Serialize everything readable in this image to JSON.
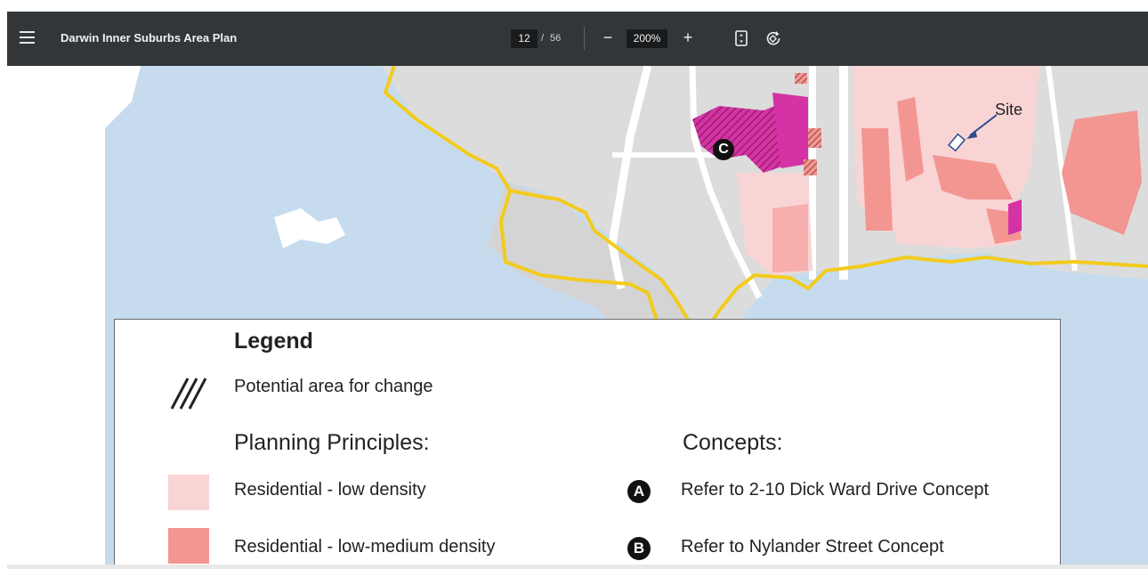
{
  "toolbar": {
    "title": "Darwin Inner Suburbs Area Plan",
    "page_current": "12",
    "page_separator": "/",
    "page_total": "56",
    "zoom_out": "−",
    "zoom_level": "200%",
    "zoom_in": "+",
    "icons": [
      "menu-icon",
      "fit-to-page-icon",
      "rotate-icon"
    ]
  },
  "map": {
    "site_label": "Site",
    "marker_c": "C",
    "colors": {
      "water": "#c6dcee",
      "land_grey": "#dcdcdc",
      "boundary": "#f2cb1d",
      "low_density": "#f9d4d4",
      "low_medium_density": "#f39692",
      "magenta": "#d533a5"
    }
  },
  "legend": {
    "title": "Legend",
    "hatch_label": "Potential area for change",
    "planning_title": "Planning Principles:",
    "concepts_title": "Concepts:",
    "items": [
      {
        "label": "Residential - low density",
        "color": "#f9d4d4"
      },
      {
        "label": "Residential - low-medium density",
        "color": "#f39692"
      }
    ],
    "concepts": [
      {
        "badge": "A",
        "label": "Refer to 2-10 Dick Ward Drive Concept"
      },
      {
        "badge": "B",
        "label": "Refer to Nylander Street Concept"
      }
    ]
  }
}
